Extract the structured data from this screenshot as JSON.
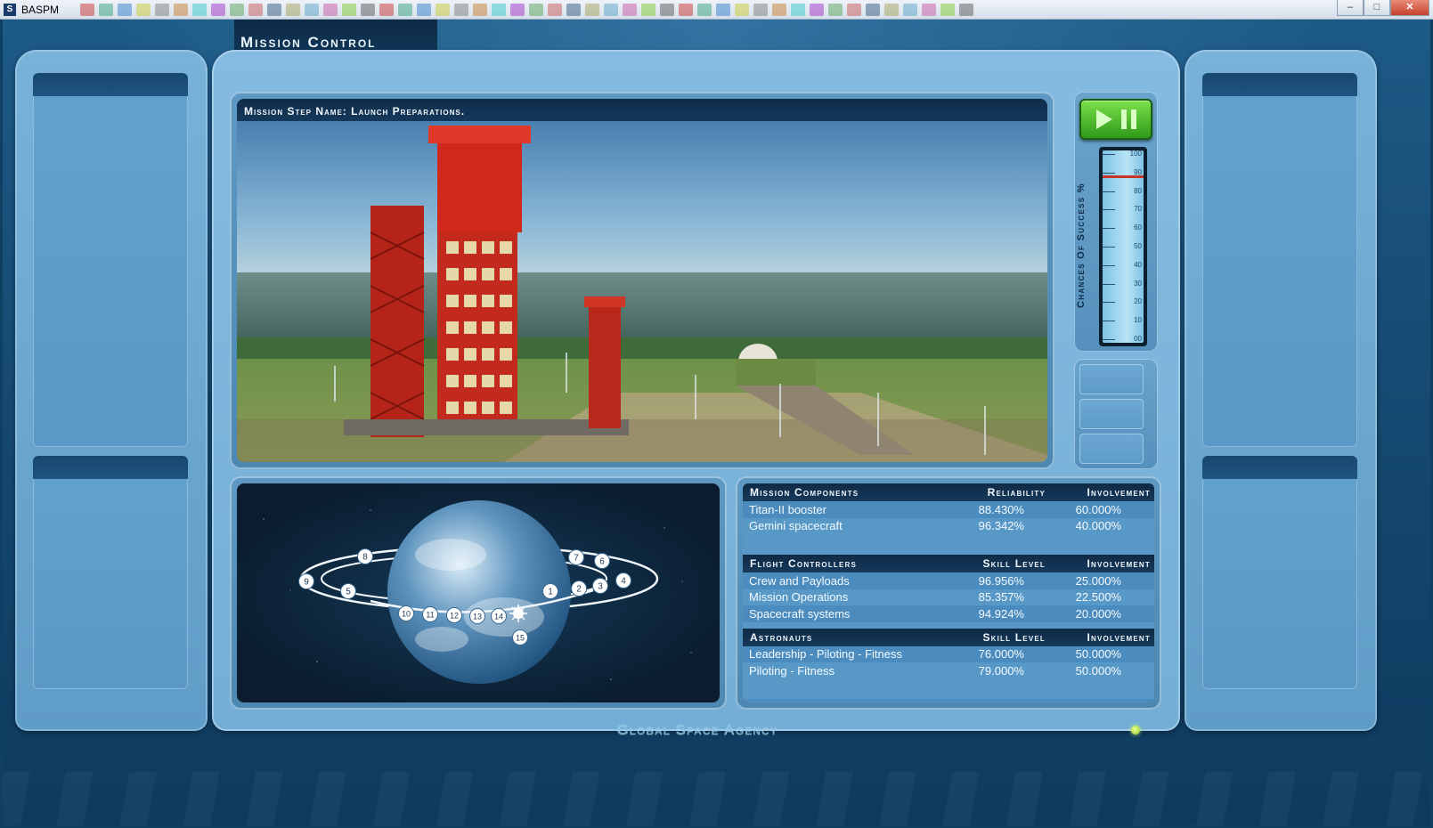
{
  "window": {
    "app_name": "BASPM",
    "minimize": "–",
    "maximize": "□",
    "close": "✕"
  },
  "header": {
    "title": "Mission Control"
  },
  "viewer": {
    "step_label": "Mission Step Name: Launch Preparations."
  },
  "gauge": {
    "label": "Chances Of Success %",
    "ticks": [
      "100",
      "90",
      "80",
      "70",
      "60",
      "50",
      "40",
      "30",
      "20",
      "10",
      "00"
    ],
    "value_percent": 88
  },
  "orbit": {
    "markers": [
      "1",
      "2",
      "3",
      "4",
      "5",
      "6",
      "7",
      "8",
      "9",
      "10",
      "11",
      "12",
      "13",
      "14",
      "15"
    ]
  },
  "stats": {
    "sections": [
      {
        "title": "Mission Components",
        "col2": "Reliability",
        "col3": "Involvement",
        "rows": [
          [
            "Titan-II booster",
            "88.430%",
            "60.000%"
          ],
          [
            "Gemini spacecraft",
            "96.342%",
            "40.000%"
          ]
        ]
      },
      {
        "title": "Flight Controllers",
        "col2": "Skill Level",
        "col3": "Involvement",
        "rows": [
          [
            "Crew and Payloads",
            "96.956%",
            "25.000%"
          ],
          [
            "Mission Operations",
            "85.357%",
            "22.500%"
          ],
          [
            "Spacecraft systems",
            "94.924%",
            "20.000%"
          ]
        ]
      },
      {
        "title": "Astronauts",
        "col2": "Skill Level",
        "col3": "Involvement",
        "rows": [
          [
            "Leadership - Piloting - Fitness",
            "76.000%",
            "50.000%"
          ],
          [
            "Piloting - Fitness",
            "79.000%",
            "50.000%"
          ]
        ]
      }
    ]
  },
  "footer": {
    "agency": "Global Space Agency"
  },
  "colors": {
    "play_green": "#3fb521",
    "frame_blue": "#7fb6dc",
    "status_led": "#b8e040"
  }
}
